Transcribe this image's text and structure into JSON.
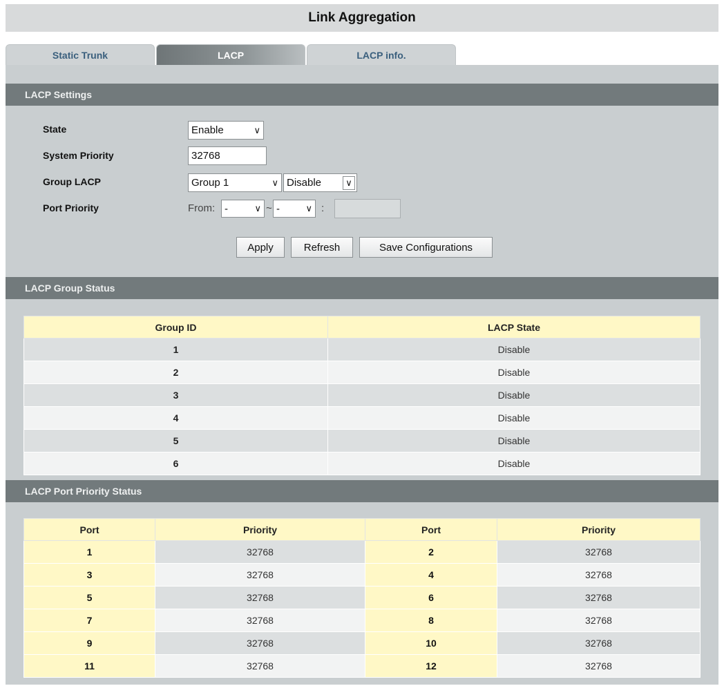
{
  "page_title": "Link Aggregation",
  "tabs": [
    {
      "label": "Static Trunk",
      "active": false
    },
    {
      "label": "LACP",
      "active": true
    },
    {
      "label": "LACP info.",
      "active": false
    }
  ],
  "settings": {
    "header": "LACP Settings",
    "state_label": "State",
    "state_value": "Enable",
    "system_priority_label": "System Priority",
    "system_priority_value": "32768",
    "group_lacp_label": "Group LACP",
    "group_value": "Group 1",
    "group_state_value": "Disable",
    "port_priority_label": "Port Priority",
    "from_label": "From:",
    "from_value": "-",
    "to_value": "-",
    "range_sep": "~",
    "colon": ":",
    "priority_input_value": "",
    "buttons": {
      "apply": "Apply",
      "refresh": "Refresh",
      "save": "Save Configurations"
    }
  },
  "group_status": {
    "header": "LACP Group Status",
    "columns": [
      "Group ID",
      "LACP State"
    ],
    "rows": [
      {
        "id": "1",
        "state": "Disable"
      },
      {
        "id": "2",
        "state": "Disable"
      },
      {
        "id": "3",
        "state": "Disable"
      },
      {
        "id": "4",
        "state": "Disable"
      },
      {
        "id": "5",
        "state": "Disable"
      },
      {
        "id": "6",
        "state": "Disable"
      }
    ]
  },
  "port_priority_status": {
    "header": "LACP Port Priority Status",
    "columns": [
      "Port",
      "Priority",
      "Port",
      "Priority"
    ],
    "rows": [
      {
        "port_a": "1",
        "prio_a": "32768",
        "port_b": "2",
        "prio_b": "32768"
      },
      {
        "port_a": "3",
        "prio_a": "32768",
        "port_b": "4",
        "prio_b": "32768"
      },
      {
        "port_a": "5",
        "prio_a": "32768",
        "port_b": "6",
        "prio_b": "32768"
      },
      {
        "port_a": "7",
        "prio_a": "32768",
        "port_b": "8",
        "prio_b": "32768"
      },
      {
        "port_a": "9",
        "prio_a": "32768",
        "port_b": "10",
        "prio_b": "32768"
      },
      {
        "port_a": "11",
        "prio_a": "32768",
        "port_b": "12",
        "prio_b": "32768"
      }
    ]
  },
  "icons": {
    "dropdown": "chevron-down-icon"
  }
}
